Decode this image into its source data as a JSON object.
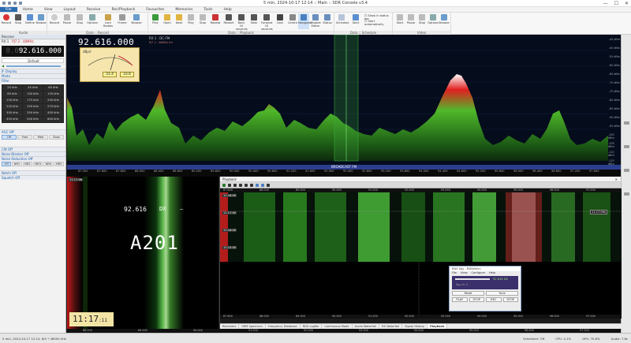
{
  "window": {
    "title": "5 min, 2024-10-17 12:14 :: Main :: SDR Console v3.4",
    "controls": [
      "—",
      "☐",
      "✕"
    ]
  },
  "menu": {
    "items": [
      "File",
      "Home",
      "View",
      "Layout",
      "Receive",
      "Rec/Playback",
      "Favourites",
      "Memories",
      "Tools",
      "Help"
    ]
  },
  "ribbon": {
    "groups": [
      {
        "label": "Audio",
        "buttons": [
          "Record",
          "Stop",
          "Define",
          "Browse"
        ]
      },
      {
        "label": "Data :: Record",
        "buttons": [
          "Record",
          "Pause",
          "Stop",
          "Options",
          "Lock Radios",
          "Frame",
          "Browse"
        ]
      },
      {
        "label": "Data :: Playback",
        "buttons": [
          "Play",
          "Open",
          "Next",
          "Play",
          "Stop",
          "Repeat",
          "Restart",
          "Back 10 seconds",
          "Seek",
          "Forward 10 seconds",
          "Gain",
          "Centre",
          "Navigator",
          "Disable Editor",
          "Status"
        ]
      },
      {
        "label": "Data :: Schedule",
        "buttons": [
          "Schedule",
          "Start"
        ]
      },
      {
        "label": "Video",
        "buttons": [
          "Start",
          "Pause",
          "Stop",
          "Options",
          "Browse"
        ]
      }
    ],
    "checks": [
      "Show in status bar",
      "Start automatically"
    ]
  },
  "receiver": {
    "panel_title": "Receive",
    "vfo_label": "RX 1",
    "vfo_info": "PJ7 2 · 48MHz",
    "frequency_dim": "0.0",
    "frequency": "92.616.000",
    "preset": "Default",
    "sections": [
      "IF Display",
      "Mode",
      "Filter"
    ],
    "mode_grid": [
      "25 kHz",
      "45 kHz",
      "65 kHz",
      "80 kHz",
      "100 kHz",
      "120 kHz",
      "150 kHz",
      "175 kHz",
      "200 kHz",
      "220 kHz",
      "250 kHz",
      "270 kHz",
      "300 kHz",
      "350 kHz",
      "400 kHz",
      "450 kHz",
      "500 kHz",
      "600 kHz"
    ],
    "agc_label": "AGC Off",
    "agc_buttons": [
      "Off",
      "Fast",
      "Med",
      "Slow"
    ],
    "cw_label": "CW Off",
    "nb_label": "Noise Blanker Off",
    "nr_label": "Noise Reduction Off",
    "nr_buttons": [
      "Off",
      "NR1",
      "NR2",
      "NR3",
      "NR4",
      "NR5"
    ],
    "notch_label": "Notch Off",
    "squelch_label": "Squelch Off"
  },
  "spectrum": {
    "frequency": "92.616.000",
    "rx_label": "RX 1 : DC-FM",
    "rx_sub": "PJ7 2 · 48MHz fm",
    "smeter_label": "dBµV",
    "smeter_values": [
      "31.4",
      "33.6"
    ],
    "station_bar": "BROADCAST FM",
    "freq_ticks": [
      "87.200",
      "87.600",
      "87.800",
      "88.000",
      "88.400",
      "88.800",
      "89.200",
      "89.600",
      "90.000",
      "90.400",
      "90.800",
      "91.200",
      "91.600",
      "92.000",
      "92.400",
      "92.800",
      "93.200",
      "93.600",
      "94.000",
      "94.400",
      "94.800",
      "95.200",
      "95.600",
      "96.000",
      "96.400",
      "96.800",
      "97.200",
      "97.600",
      "98.000"
    ],
    "db_ticks": [
      "-45 dBm",
      "-50 dBm",
      "-55 dBm",
      "-60 dBm",
      "-65 dBm",
      "-70 dBm",
      "-75 dBm",
      "-80 dBm",
      "-85 dBm",
      "-90 dBm",
      "-95 dBm",
      "-100 dBm",
      "-105 dBm",
      "-110 dBm",
      "-115 dBm",
      "-120 dBm"
    ]
  },
  "rds": {
    "time_stamp": "11:17:06",
    "freq_text": "92.616",
    "dx_text": "DX",
    "dash": "–",
    "ps_name": "A201",
    "clock": "11:17",
    "clock_sec": ":11"
  },
  "playback": {
    "title": "Playback",
    "timestamps": [
      "11:18:00",
      "11:17:00",
      "11:16:00",
      "11:15:00"
    ],
    "marker": "11:17:09s",
    "tabs": [
      "Receivers",
      "SRM Spectrum",
      "Frequency Database",
      "RDS Logfile",
      "Continuous Mode",
      "Audio Waterfall",
      "RX Waterfall",
      "Signal History",
      "Playback"
    ],
    "active_tab": "Playback",
    "axis_ticks": [
      "87.600",
      "88.000",
      "89.000",
      "90.000",
      "91.000",
      "92.000",
      "93.000",
      "94.000",
      "95.000",
      "96.000",
      "97.000"
    ]
  },
  "dialog": {
    "title": "RDS Spy - RDSeSrcn",
    "menu": [
      "File",
      "View",
      "Configure",
      "Help"
    ],
    "display_text": "92.616 DX",
    "display_sub": "Spy-ch: 4",
    "reset_label": "Reset",
    "tune_label": "Tune",
    "buttons": [
      "PLAY",
      "STOP",
      "REC",
      "STOP"
    ]
  },
  "status": {
    "left": "5 min, 2024-10-17 12:14, 8/0 • 48000 kHz",
    "items": [
      "Scheduler: Off",
      "CPU: 0.1%",
      "GPU: 70.8%",
      "Audio: 7.8s"
    ]
  }
}
